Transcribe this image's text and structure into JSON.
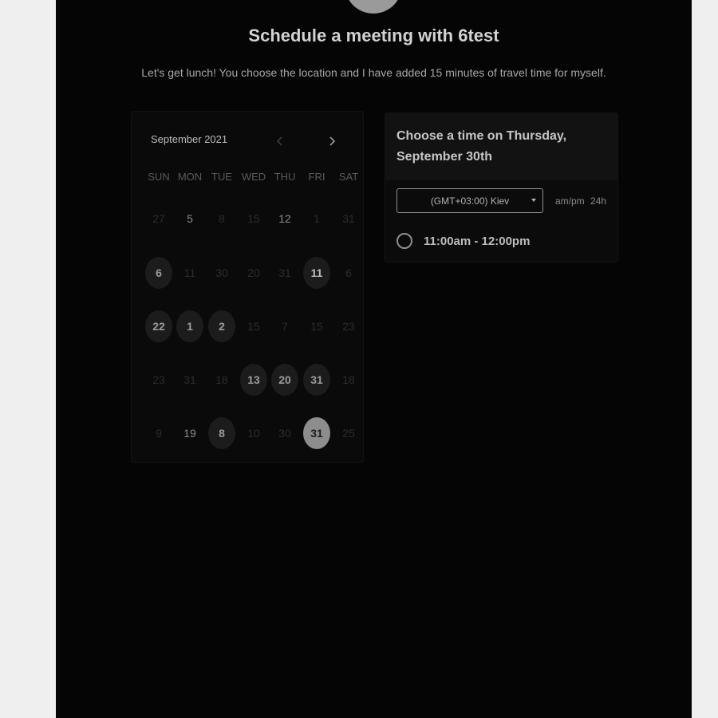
{
  "header": {
    "title": "Schedule a meeting with 6test",
    "description": "Let's get lunch! You choose the location and I have added 15 minutes of travel time for myself."
  },
  "calendar": {
    "month_label": "September 2021",
    "prev_icon": "chevron-left-icon",
    "next_icon": "chevron-right-icon",
    "weekdays": [
      "SUN",
      "MON",
      "TUE",
      "WED",
      "THU",
      "FRI",
      "SAT"
    ],
    "weeks": [
      [
        {
          "label": "27",
          "state": "muted"
        },
        {
          "label": "5",
          "state": "plain"
        },
        {
          "label": "8",
          "state": "muted"
        },
        {
          "label": "15",
          "state": "muted"
        },
        {
          "label": "12",
          "state": "plain"
        },
        {
          "label": "1",
          "state": "muted"
        },
        {
          "label": "31",
          "state": "muted"
        }
      ],
      [
        {
          "label": "6",
          "state": "available"
        },
        {
          "label": "11",
          "state": "muted"
        },
        {
          "label": "30",
          "state": "muted"
        },
        {
          "label": "20",
          "state": "muted"
        },
        {
          "label": "31",
          "state": "muted"
        },
        {
          "label": "11",
          "state": "available"
        },
        {
          "label": "6",
          "state": "muted"
        }
      ],
      [
        {
          "label": "22",
          "state": "available"
        },
        {
          "label": "1",
          "state": "available"
        },
        {
          "label": "2",
          "state": "available"
        },
        {
          "label": "15",
          "state": "muted"
        },
        {
          "label": "7",
          "state": "muted"
        },
        {
          "label": "15",
          "state": "muted"
        },
        {
          "label": "23",
          "state": "muted"
        }
      ],
      [
        {
          "label": "23",
          "state": "muted"
        },
        {
          "label": "31",
          "state": "muted"
        },
        {
          "label": "18",
          "state": "muted"
        },
        {
          "label": "13",
          "state": "available"
        },
        {
          "label": "20",
          "state": "available"
        },
        {
          "label": "31",
          "state": "available"
        },
        {
          "label": "18",
          "state": "muted"
        }
      ],
      [
        {
          "label": "9",
          "state": "muted"
        },
        {
          "label": "19",
          "state": "plain"
        },
        {
          "label": "8",
          "state": "available"
        },
        {
          "label": "10",
          "state": "muted"
        },
        {
          "label": "30",
          "state": "muted"
        },
        {
          "label": "31",
          "state": "selected"
        },
        {
          "label": "25",
          "state": "muted"
        }
      ]
    ]
  },
  "time_panel": {
    "heading": "Choose a time on Thursday, September 30th",
    "timezone": "(GMT+03:00) Kiev",
    "format_ampm": "am/pm",
    "format_24h": "24h",
    "slots": [
      "11:00am - 12:00pm"
    ]
  }
}
